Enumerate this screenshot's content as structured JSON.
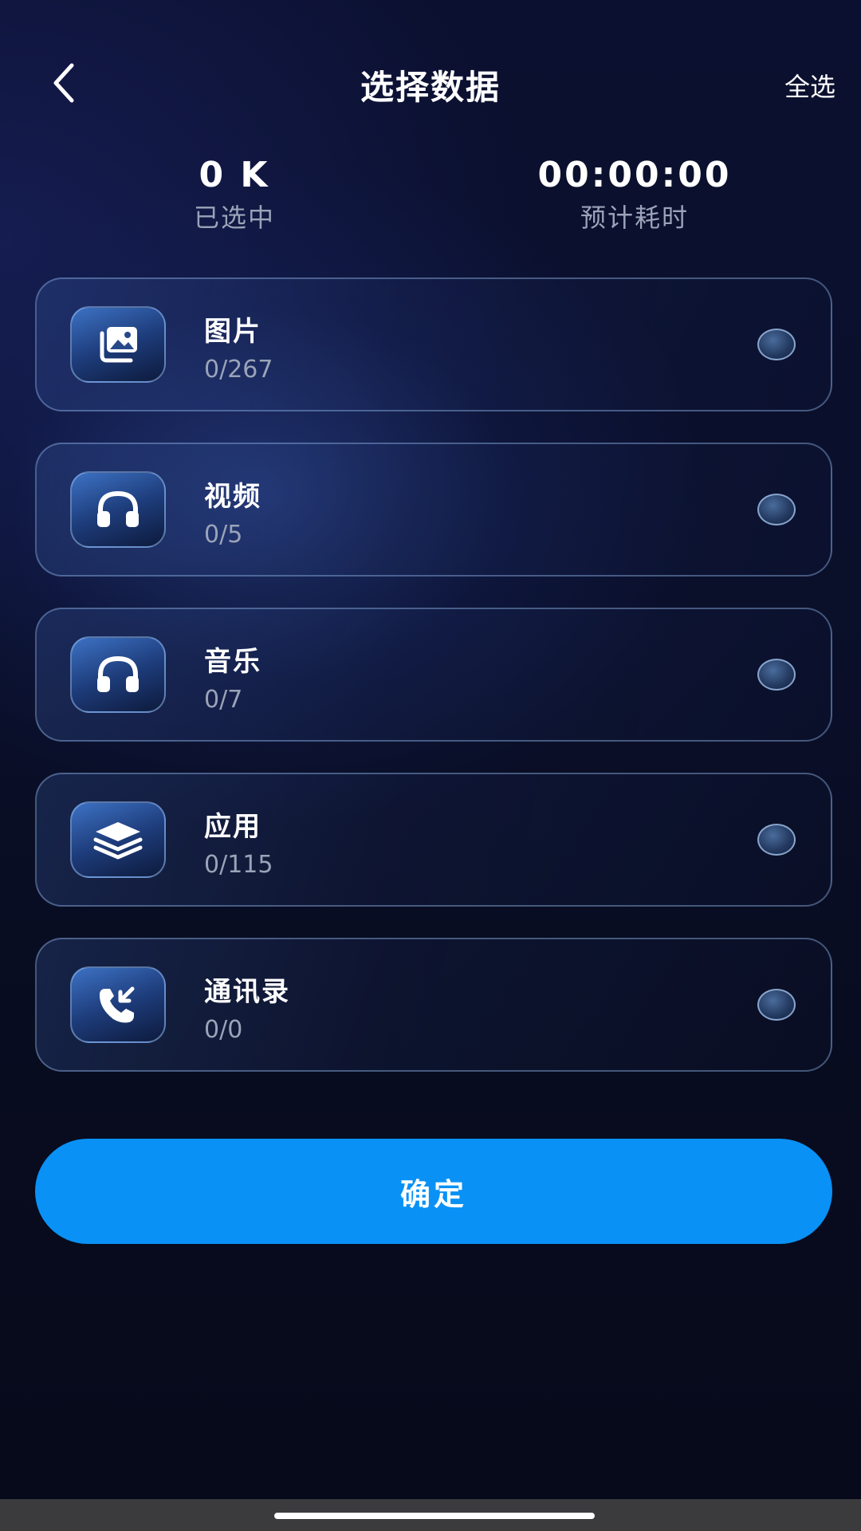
{
  "header": {
    "title": "选择数据",
    "select_all_label": "全选"
  },
  "stats": {
    "selected_size": "0 K",
    "selected_label": "已选中",
    "estimated_time": "00:00:00",
    "estimated_time_label": "预计耗时"
  },
  "items": [
    {
      "label": "图片",
      "count": "0/267",
      "icon": "images-icon",
      "selected": false
    },
    {
      "label": "视频",
      "count": "0/5",
      "icon": "headphones-icon",
      "selected": false
    },
    {
      "label": "音乐",
      "count": "0/7",
      "icon": "headphones-icon",
      "selected": false
    },
    {
      "label": "应用",
      "count": "0/115",
      "icon": "layers-icon",
      "selected": false
    },
    {
      "label": "通讯录",
      "count": "0/0",
      "icon": "phone-incoming-icon",
      "selected": false
    }
  ],
  "confirm_label": "确定",
  "colors": {
    "accent": "#0991f5",
    "background": "#080c1f",
    "muted_text": "#9aa3b8"
  }
}
